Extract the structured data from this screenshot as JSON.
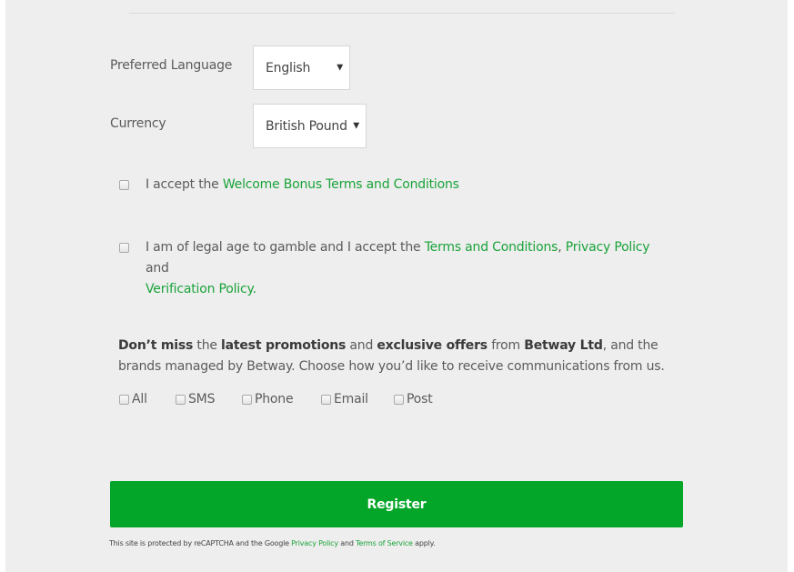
{
  "form": {
    "language": {
      "label": "Preferred Language",
      "selected": "English"
    },
    "currency": {
      "label": "Currency",
      "selected": "British Pound"
    },
    "dropdown_arrow": "▼",
    "bonus_terms": {
      "checked": false,
      "prefix": "I accept the ",
      "link": "Welcome Bonus Terms and Conditions"
    },
    "legal_terms": {
      "checked": false,
      "prefix": "I am of legal age to gamble and I accept the ",
      "link_terms": "Terms and Conditions",
      "sep": ", ",
      "link_privacy": "Privacy Policy",
      "and": " and",
      "link_verification": "Verification Policy",
      "period": "."
    },
    "promo": {
      "bold1": "Don’t miss",
      "t1": " the ",
      "bold2": "latest promotions",
      "t2": " and ",
      "bold3": "exclusive offers",
      "t3": " from ",
      "bold4": "Betway Ltd",
      "t4": ", and the brands managed by Betway. Choose how you’d like to receive communications from us."
    },
    "channels": [
      {
        "label": "All",
        "checked": false
      },
      {
        "label": "SMS",
        "checked": false
      },
      {
        "label": "Phone",
        "checked": false
      },
      {
        "label": "Email",
        "checked": false
      },
      {
        "label": "Post",
        "checked": false
      }
    ],
    "register_label": "Register",
    "recaptcha": {
      "prefix": "This site is protected by reCAPTCHA and the Google ",
      "privacy": "Privacy Policy",
      "and": " and ",
      "terms": "Terms of Service",
      "suffix": " apply."
    }
  },
  "colors": {
    "accent_green": "#03a629",
    "link_green": "#1aa33a",
    "panel_bg": "#eeeeee"
  }
}
